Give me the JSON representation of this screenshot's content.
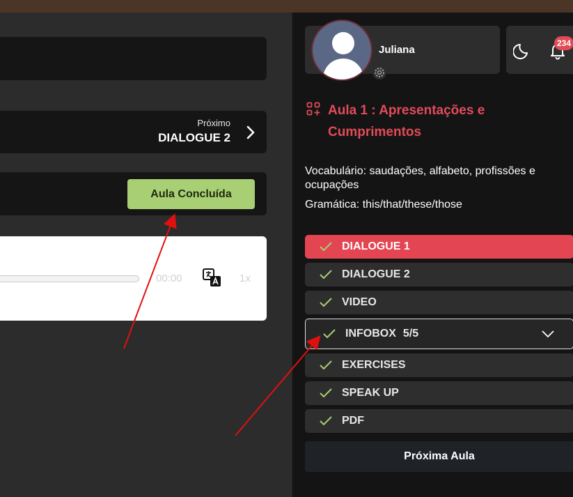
{
  "main": {
    "next": {
      "label": "Próximo",
      "title": "DIALOGUE 2"
    },
    "done_button": "Aula Concluída",
    "player": {
      "time": "00:00",
      "speed": "1x"
    }
  },
  "sidebar": {
    "user": {
      "name": "Juliana"
    },
    "notifications": {
      "count": "234"
    },
    "lesson": {
      "title": "Aula 1 : Apresentações e Cumprimentos",
      "vocab": "Vocabulário: saudações, alfabeto, profissões e ocupações",
      "grammar": "Gramática: this/that/these/those"
    },
    "items": [
      {
        "label": "DIALOGUE 1"
      },
      {
        "label": "DIALOGUE 2"
      },
      {
        "label": "VIDEO"
      },
      {
        "label": "INFOBOX",
        "count": "5/5"
      },
      {
        "label": "EXERCISES"
      },
      {
        "label": "SPEAK UP"
      },
      {
        "label": "PDF"
      }
    ],
    "next_lesson": "Próxima Aula"
  },
  "colors": {
    "accent": "#e44552",
    "done": "#a9cf74",
    "check": "#a9cf74"
  }
}
